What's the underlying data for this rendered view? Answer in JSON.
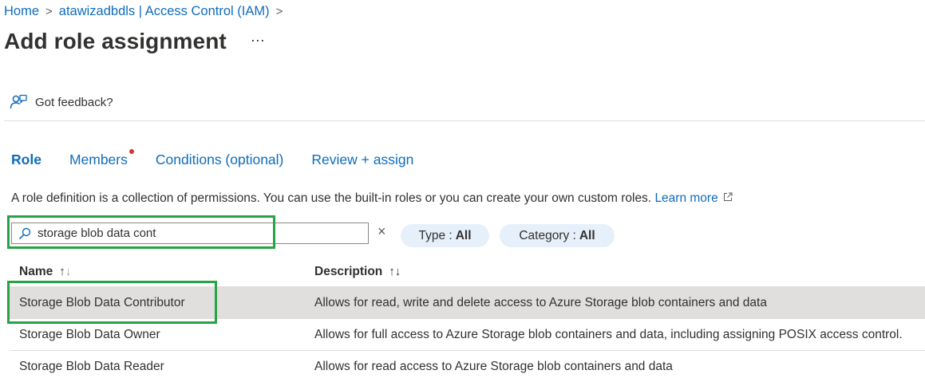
{
  "breadcrumb": [
    "Home",
    "atawizadbdls | Access Control (IAM)"
  ],
  "page_title": "Add role assignment",
  "more_label": "···",
  "feedback_label": "Got feedback?",
  "tabs": [
    {
      "label": "Role",
      "active": true
    },
    {
      "label": "Members",
      "has_indicator": true
    },
    {
      "label": "Conditions (optional)"
    },
    {
      "label": "Review + assign"
    }
  ],
  "info": {
    "text": "A role definition is a collection of permissions. You can use the built-in roles or you can create your own custom roles.",
    "link": "Learn more"
  },
  "search": {
    "value": "storage blob data cont",
    "clear_label": "×"
  },
  "filters": {
    "type": {
      "label": "Type :",
      "value": "All"
    },
    "category": {
      "label": "Category :",
      "value": "All"
    }
  },
  "table": {
    "headers": {
      "name": "Name",
      "description": "Description"
    },
    "rows": [
      {
        "name": "Storage Blob Data Contributor",
        "description": "Allows for read, write and delete access to Azure Storage blob containers and data",
        "selected": true
      },
      {
        "name": "Storage Blob Data Owner",
        "description": "Allows for full access to Azure Storage blob containers and data, including assigning POSIX access control."
      },
      {
        "name": "Storage Blob Data Reader",
        "description": "Allows for read access to Azure Storage blob containers and data"
      }
    ]
  },
  "colors": {
    "accent": "#0f6cbd",
    "highlight": "#27a345",
    "indicator": "#d13438",
    "pill_bg": "#e6f0fa",
    "selected_row": "#e1dfdd"
  }
}
